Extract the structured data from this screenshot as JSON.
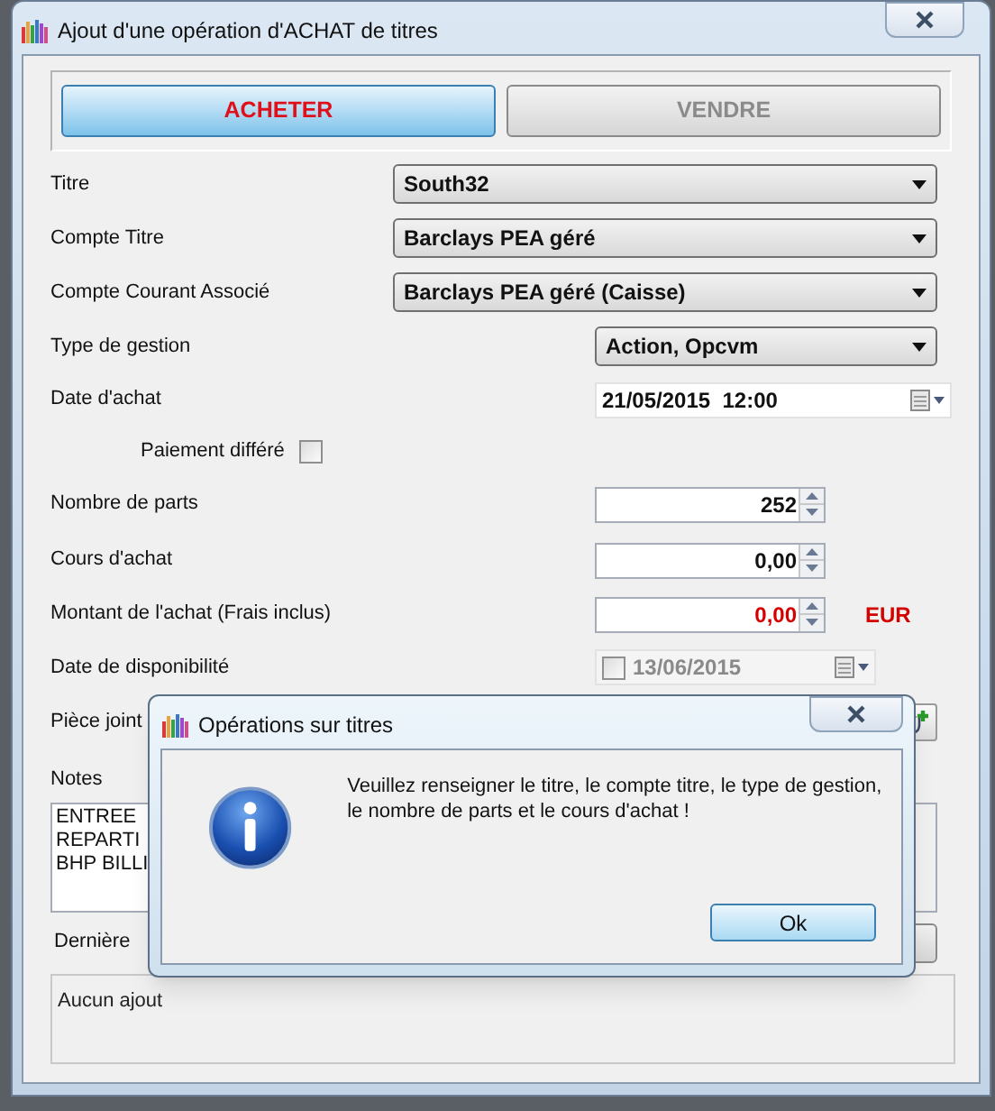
{
  "window": {
    "title": "Ajout d'une opération d'ACHAT de titres"
  },
  "mode_buttons": [
    {
      "label": "ACHETER",
      "selected": true
    },
    {
      "label": "VENDRE",
      "selected": false
    }
  ],
  "fields": [
    {
      "kind": "select",
      "label": "Titre",
      "value": "South32"
    },
    {
      "kind": "select",
      "label": "Compte Titre",
      "value": "Barclays PEA géré"
    },
    {
      "kind": "select",
      "label": "Compte Courant Associé",
      "value": "Barclays PEA géré (Caisse)"
    },
    {
      "kind": "select_narrow",
      "label": "Type de gestion",
      "value": "Action, Opcvm"
    },
    {
      "kind": "datetime",
      "label": "Date d'achat",
      "value": "21/05/2015  12:00"
    },
    {
      "kind": "checkbox",
      "label": "Paiement différé",
      "checked": false
    },
    {
      "kind": "number",
      "label": "Nombre de parts",
      "value": "252"
    },
    {
      "kind": "number",
      "label": "Cours d'achat",
      "value": "0,00"
    },
    {
      "kind": "amount",
      "label": "Montant de l'achat (Frais inclus)",
      "value": "0,00",
      "unit": "EUR"
    },
    {
      "kind": "optional_date",
      "label": "Date de disponibilité",
      "value": "13/06/2015",
      "checked": false
    },
    {
      "kind": "attachment",
      "label": "Pièce joint"
    }
  ],
  "notes": {
    "label": "Notes",
    "lines": [
      "ENTREE",
      "REPARTI",
      "BHP BILLI"
    ]
  },
  "last_operation": {
    "label": "Dernière",
    "value": "Aucun ajout"
  },
  "dialog": {
    "title": "Opérations sur titres",
    "message": "Veuillez renseigner le titre, le compte titre, le type de gestion, le nombre de parts et le cours d'achat !",
    "button": "Ok"
  }
}
